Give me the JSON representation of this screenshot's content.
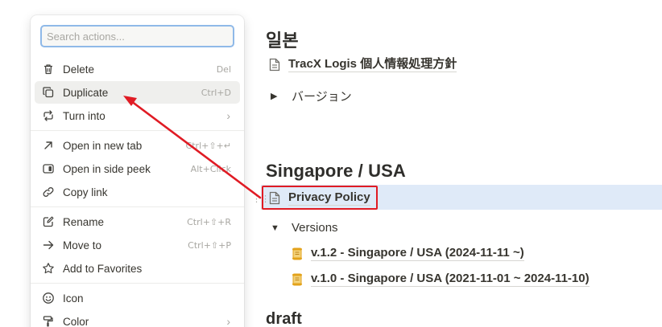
{
  "menu": {
    "search_placeholder": "Search actions...",
    "items": [
      {
        "label": "Delete",
        "shortcut": "Del",
        "icon": "trash-icon"
      },
      {
        "label": "Duplicate",
        "shortcut": "Ctrl+D",
        "icon": "duplicate-icon"
      },
      {
        "label": "Turn into",
        "shortcut": "›",
        "icon": "turn-into-icon"
      },
      {
        "label": "Open in new tab",
        "shortcut": "Ctrl+⇧+↵",
        "icon": "open-new-tab-icon"
      },
      {
        "label": "Open in side peek",
        "shortcut": "Alt+Click",
        "icon": "side-peek-icon"
      },
      {
        "label": "Copy link",
        "shortcut": "",
        "icon": "link-icon"
      },
      {
        "label": "Rename",
        "shortcut": "Ctrl+⇧+R",
        "icon": "rename-icon"
      },
      {
        "label": "Move to",
        "shortcut": "Ctrl+⇧+P",
        "icon": "move-to-icon"
      },
      {
        "label": "Add to Favorites",
        "shortcut": "",
        "icon": "star-icon"
      },
      {
        "label": "Icon",
        "shortcut": "",
        "icon": "smiley-icon"
      },
      {
        "label": "Color",
        "shortcut": "›",
        "icon": "paint-roller-icon"
      }
    ]
  },
  "content": {
    "section_japan": "일본",
    "japan_doc": "TracX Logis 個人情報処理方針",
    "japan_toggle": "バージョン",
    "section_sg": "Singapore / USA",
    "sg_doc": "Privacy Policy",
    "sg_toggle": "Versions",
    "sg_versions": [
      "v.1.2 - Singapore / USA (2024-11-11 ~)",
      "v.1.0 - Singapore / USA (2021-11-01 ~ 2024-11-10)"
    ],
    "section_draft": "draft"
  },
  "colors": {
    "annotation_red": "#e01b24",
    "selection_blue": "#dfeaf8",
    "search_focus": "#8fb9e8",
    "scroll_icon_gold": "#e3a21a"
  }
}
